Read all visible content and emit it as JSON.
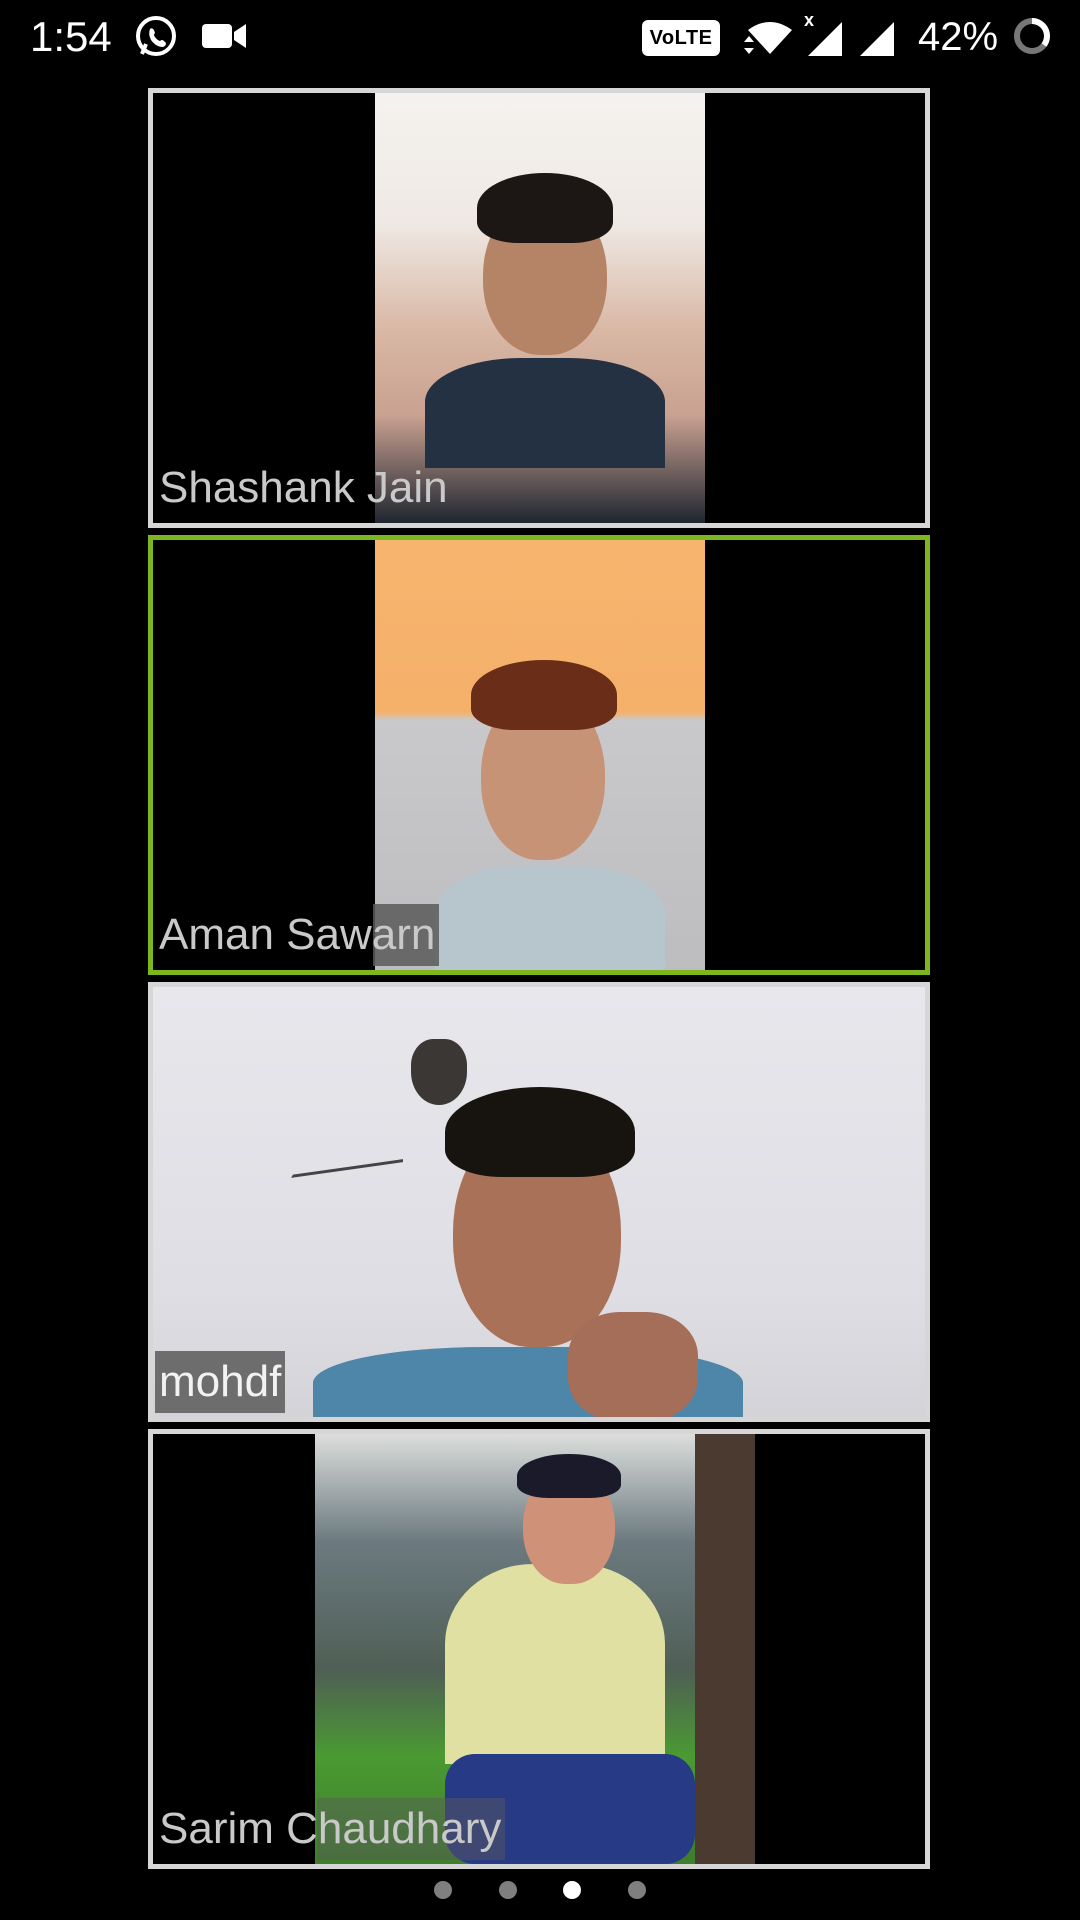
{
  "status_bar": {
    "time": "1:54",
    "volte": "VoLTE",
    "data_off_mark": "x",
    "battery": "42%",
    "icons": [
      "whatsapp-icon",
      "video-camera-icon",
      "wifi-data-icon",
      "signal-icon",
      "signal-icon",
      "battery-icon"
    ]
  },
  "participants": [
    {
      "name": "Shashank Jain",
      "active": false
    },
    {
      "name": "Aman Sawarn",
      "active": true
    },
    {
      "name": "mohdf",
      "active": false
    },
    {
      "name": "Sarim Chaudhary",
      "active": false
    }
  ],
  "pager": {
    "count": 4,
    "current": 3
  },
  "colors": {
    "active_speaker_border": "#7cb71f",
    "tile_border": "#d6d6d6",
    "background": "#000000"
  }
}
